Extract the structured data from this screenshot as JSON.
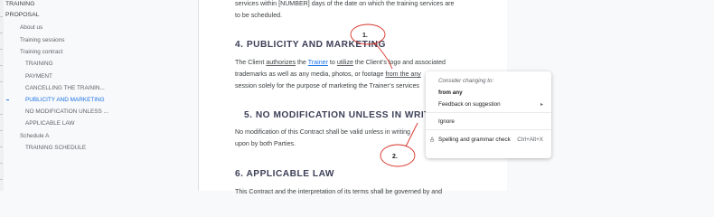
{
  "outline": {
    "items": [
      {
        "label": "TRAINING",
        "level": "h1"
      },
      {
        "label": "PROPOSAL",
        "level": "h1"
      },
      {
        "label": "About us",
        "level": "h2"
      },
      {
        "label": "Training sessions",
        "level": "h2"
      },
      {
        "label": "Training contract",
        "level": "h2"
      },
      {
        "label": "TRAINING",
        "level": "h3"
      },
      {
        "label": "PAYMENT",
        "level": "h3"
      },
      {
        "label": "CANCELLING THE TRAININ...",
        "level": "h3"
      },
      {
        "label": "PUBLICITY AND MARKETING",
        "level": "h3",
        "active": true
      },
      {
        "label": "NO MODIFICATION UNLESS ...",
        "level": "h3"
      },
      {
        "label": "APPLICABLE LAW",
        "level": "h3"
      },
      {
        "label": "Schedule A",
        "level": "h2"
      },
      {
        "label": "TRAINING SCHEDULE",
        "level": "h3"
      }
    ]
  },
  "document": {
    "para_top_1": "services within [NUMBER] days of the date on which the training services are",
    "para_top_2": "to be scheduled.",
    "h4": "4.   PUBLICITY AND MARKETING",
    "p4_line1": {
      "a": "The Client ",
      "b": "authorizes",
      "c": " the ",
      "d": "Trainer",
      "e": " to ",
      "f": "utilize",
      "g": " the Client’s logo and associated"
    },
    "p4_line2": "trademarks as well as any media, photos, or footage ",
    "p4_line2_flag": "from the any",
    "p4_line3": "session solely for the purpose of marketing the Trainer’s services",
    "h5": "5. NO MODIFICATION UNLESS IN WRITING",
    "p5_line1": "No modification of this Contract shall be valid unless in writing",
    "p5_line2": "upon by both Parties.",
    "h6": "6.   APPLICABLE LAW",
    "p6_line1": "This Contract and the interpretation of its terms shall be governed by and"
  },
  "context_menu": {
    "header": "Consider changing to:",
    "suggestion": "from any",
    "feedback": "Feedback on suggestion",
    "ignore": "Ignore",
    "spell": "Spelling and grammar check",
    "spell_shortcut": "Ctrl+Alt+X"
  },
  "annotations": {
    "marker1": "1.",
    "marker2": "2.",
    "color": "#d93025"
  },
  "colors": {
    "accent": "#1a73e8",
    "heading": "#3c3f57"
  }
}
